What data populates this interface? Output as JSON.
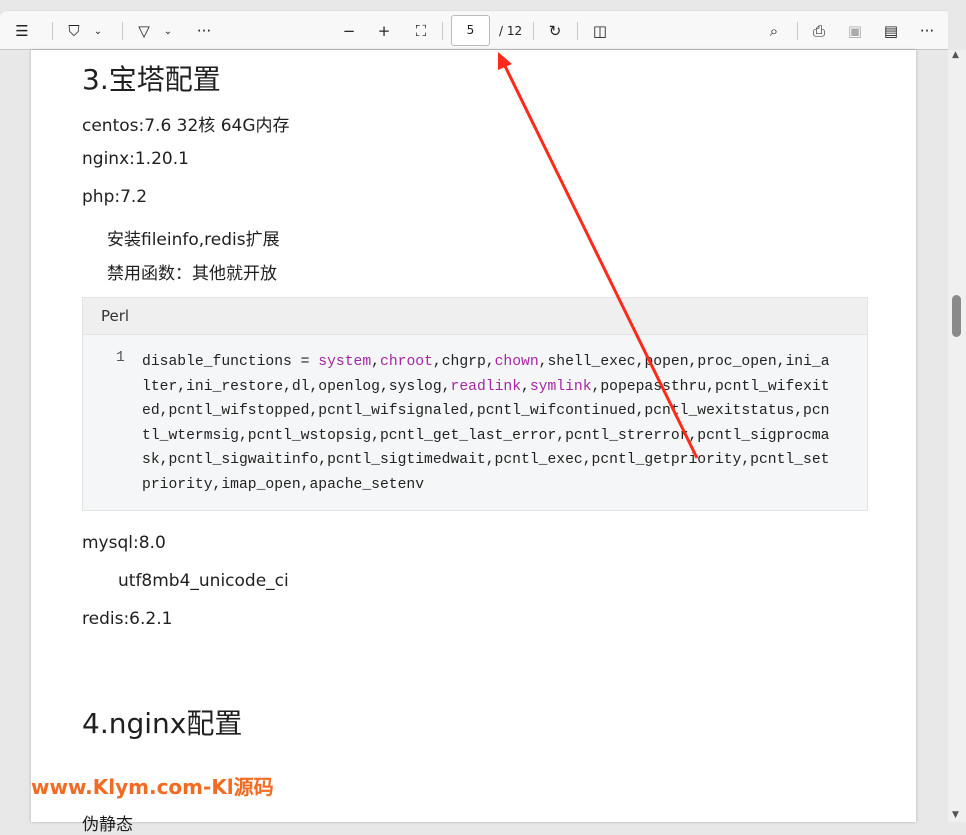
{
  "toolbar": {
    "page_current": "5",
    "page_total": "/ 12",
    "icons": [
      "contents-icon",
      "highlight-icon",
      "draw-icon",
      "more-icon",
      "zoom-out-icon",
      "zoom-in-icon",
      "fit-page-icon",
      "rotate-icon",
      "page-view-icon",
      "search-icon",
      "print-icon",
      "save-icon",
      "save-as-icon",
      "more-icon"
    ]
  },
  "doc": {
    "h3": "3.宝塔配置",
    "centos": "centos:7.6  32核 64G内存",
    "nginx": "nginx:1.20.1",
    "php": "php:7.2",
    "php_ext": "安装fileinfo,redis扩展",
    "php_disable": "禁用函数：其他就开放",
    "code_lang": "Perl",
    "code_line_no": "1",
    "code_lines": [
      [
        "disable_functions = ",
        "system",
        ",",
        "chroot",
        ",chgrp,",
        "chown",
        ",shell_exec,popen,proc_open,ini_a"
      ],
      [
        "lter,ini_restore,dl,openlog,syslog,",
        "readlink",
        ",",
        "symlink",
        ",popepassthru,pcntl_wifexit"
      ],
      [
        "ed,pcntl_wifstopped,pcntl_wifsignaled,pcntl_wifcontinued,pcntl_wexitstatus,pcn"
      ],
      [
        "tl_wtermsig,pcntl_wstopsig,pcntl_get_last_error,pcntl_strerror,pcntl_sigprocma"
      ],
      [
        "sk,pcntl_sigwaitinfo,pcntl_sigtimedwait,pcntl_exec,pcntl_getpriority,pcntl_set"
      ],
      [
        "priority,imap_open,apache_setenv"
      ]
    ],
    "mysql": "mysql:8.0",
    "mysql_collation": "utf8mb4_unicode_ci",
    "redis": "redis:6.2.1",
    "h4": "4.nginx配置",
    "rewrite": "伪静态"
  },
  "watermark": "www.Klym.com-Kl源码",
  "colors": {
    "keyword": "#a626a4",
    "annotation_arrow": "#ff2a1a",
    "watermark": "#f26b22"
  }
}
